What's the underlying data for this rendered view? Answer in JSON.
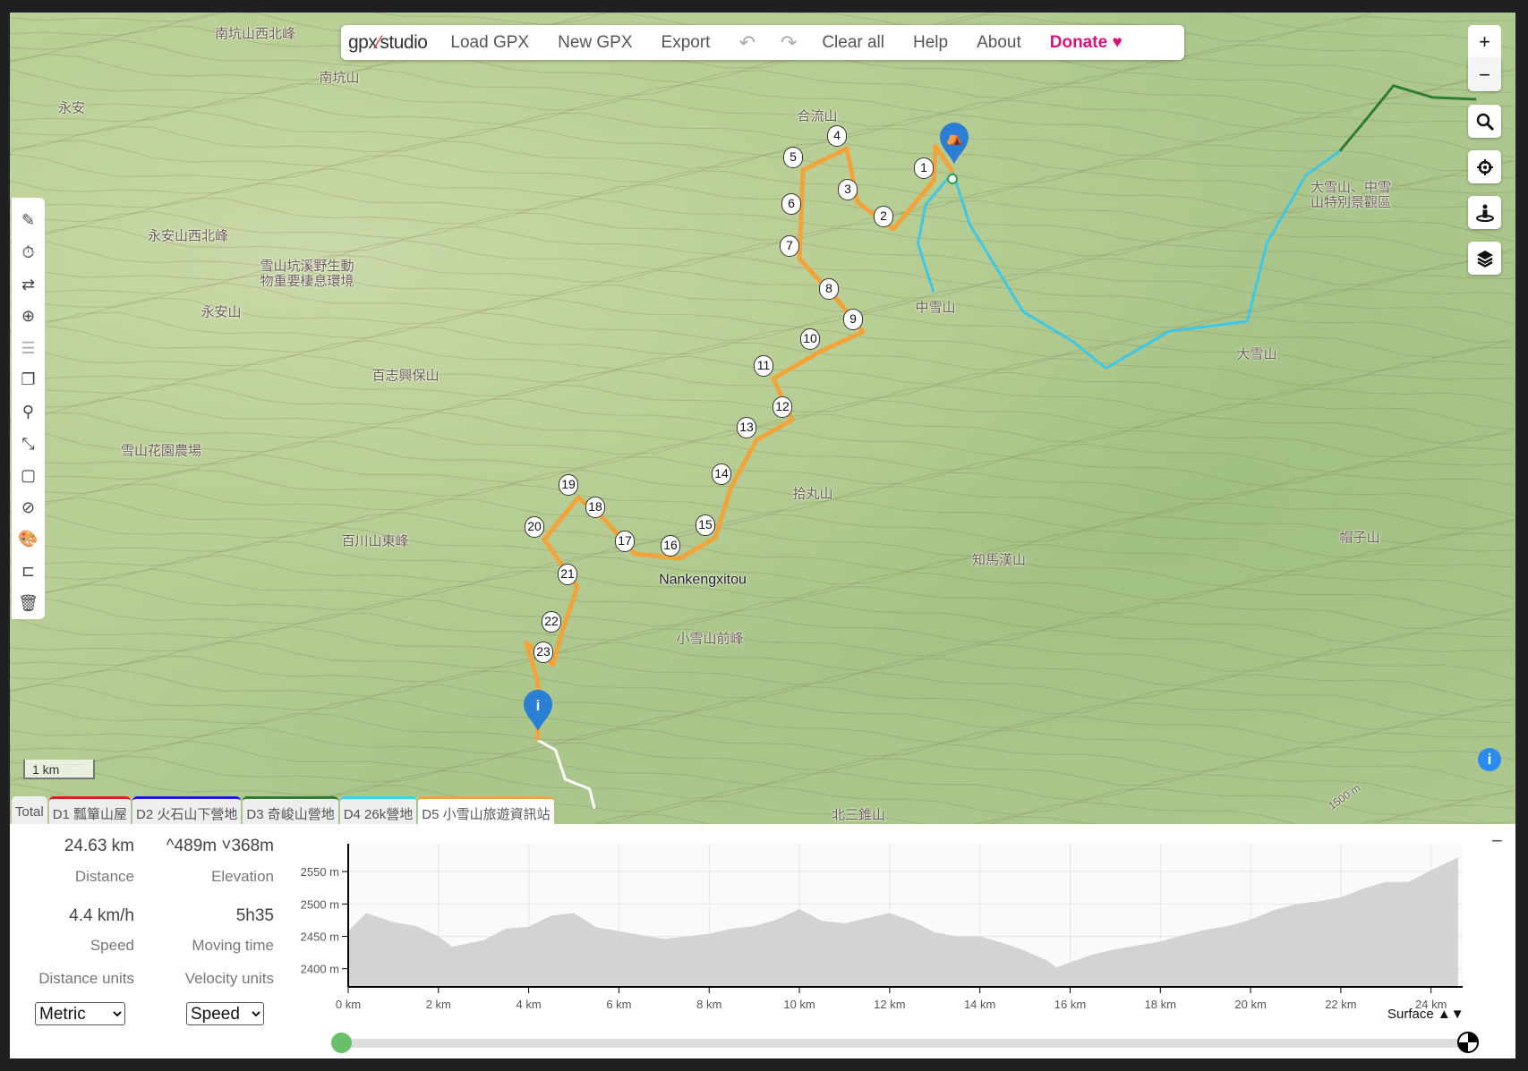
{
  "topbar": {
    "logo_left": "gpx",
    "logo_right": "studio",
    "load": "Load GPX",
    "new": "New GPX",
    "export": "Export",
    "undo_icon": "undo-icon",
    "redo_icon": "redo-icon",
    "clear": "Clear all",
    "help": "Help",
    "about": "About",
    "donate": "Donate",
    "heart": "♥"
  },
  "left_tools": [
    "pencil-icon",
    "stopwatch-icon",
    "reverse-icon",
    "plus-circle-icon",
    "list-icon",
    "copy-icon",
    "map-pin-icon",
    "compress-icon",
    "crop-icon",
    "eye-off-icon",
    "palette-icon",
    "folder-tree-icon",
    "trash-icon"
  ],
  "right_controls": {
    "zoom_in": "+",
    "zoom_out": "−",
    "search": "search-icon",
    "locate": "crosshair-icon",
    "streetview": "person-icon",
    "layers": "layers-icon"
  },
  "map": {
    "places": [
      {
        "t": "南坑山西北峰"
      },
      {
        "t": "南坑山"
      },
      {
        "t": "永安"
      },
      {
        "t": "合流山"
      },
      {
        "t": "永安山西北峰"
      },
      {
        "t": "雪山坑溪野生動\n物重要棲息環境"
      },
      {
        "t": "永安山"
      },
      {
        "t": "中雪山"
      },
      {
        "t": "大雪山、中雪\n山特別景觀區"
      },
      {
        "t": "大雪山"
      },
      {
        "t": "百志興保山"
      },
      {
        "t": "雪山花園農場"
      },
      {
        "t": "拾丸山"
      },
      {
        "t": "百川山東峰"
      },
      {
        "t": "知馬漢山"
      },
      {
        "t": "帽子山"
      },
      {
        "t": "Nankengxitou"
      },
      {
        "t": "小雪山前峰"
      },
      {
        "t": "北三錐山"
      },
      {
        "t": "1500 m"
      }
    ],
    "waypoints": [
      "1",
      "2",
      "3",
      "4",
      "5",
      "6",
      "7",
      "8",
      "9",
      "10",
      "11",
      "12",
      "13",
      "14",
      "15",
      "16",
      "17",
      "18",
      "19",
      "20",
      "21",
      "22",
      "23"
    ],
    "scale": "1 km",
    "route_colors": {
      "current": "#f2a33a",
      "d4": "#3fc7e6",
      "d3": "#2e7d32",
      "after": "#ffffff"
    }
  },
  "tabs": [
    {
      "label": "Total",
      "color": ""
    },
    {
      "label": "D1 瓢簞山屋",
      "color": "#e02020"
    },
    {
      "label": "D2 火石山下營地",
      "color": "#1a1ae0"
    },
    {
      "label": "D3 奇峻山營地",
      "color": "#2e7d32"
    },
    {
      "label": "D4 26k營地",
      "color": "#3fd0f0"
    },
    {
      "label": "D5 小雪山旅遊資訊站",
      "color": "#f2a33a"
    }
  ],
  "stats": {
    "distance": "24.63 km",
    "distance_label": "Distance",
    "elev_up": "489m",
    "elev_down": "368m",
    "elevation_label": "Elevation",
    "speed": "4.4 km/h",
    "speed_label": "Speed",
    "moving_time": "5h35",
    "moving_time_label": "Moving time",
    "distance_units_label": "Distance units",
    "velocity_units_label": "Velocity units",
    "distance_units": "Metric",
    "velocity_units": "Speed"
  },
  "panel": {
    "collapse": "−",
    "surface": "Surface",
    "surface_arrows": "▲▼"
  },
  "chart_data": {
    "type": "area",
    "xlabel": "",
    "ylabel": "",
    "xlim": [
      0,
      24.7
    ],
    "ylim": [
      2372,
      2593
    ],
    "xticks": [
      0,
      2,
      4,
      6,
      8,
      10,
      12,
      14,
      16,
      18,
      20,
      22,
      24
    ],
    "xtick_labels": [
      "0 km",
      "2 km",
      "4 km",
      "6 km",
      "8 km",
      "10 km",
      "12 km",
      "14 km",
      "16 km",
      "18 km",
      "20 km",
      "22 km",
      "24 km"
    ],
    "yticks": [
      2400,
      2450,
      2500,
      2550
    ],
    "ytick_labels": [
      "2400 m",
      "2450 m",
      "2500 m",
      "2550 m"
    ],
    "grid": true,
    "fill": "#d3d3d3",
    "x": [
      0,
      0.4,
      1,
      1.5,
      2,
      2.3,
      3,
      3.5,
      4,
      4.5,
      5,
      5.5,
      6,
      6.5,
      7,
      7.5,
      8,
      8.5,
      9,
      9.5,
      10,
      10.5,
      11,
      11.5,
      12,
      12.5,
      13,
      13.5,
      14,
      14.5,
      15,
      15.5,
      15.7,
      16,
      16.5,
      17,
      17.5,
      18,
      18.5,
      19,
      19.5,
      20,
      20.5,
      21,
      21.5,
      22,
      22.5,
      23,
      23.5,
      24,
      24.6
    ],
    "y": [
      2458,
      2486,
      2472,
      2466,
      2450,
      2434,
      2444,
      2462,
      2465,
      2482,
      2486,
      2464,
      2458,
      2452,
      2446,
      2450,
      2454,
      2462,
      2466,
      2476,
      2492,
      2474,
      2470,
      2478,
      2486,
      2474,
      2456,
      2450,
      2450,
      2440,
      2428,
      2412,
      2402,
      2410,
      2422,
      2430,
      2436,
      2442,
      2452,
      2460,
      2466,
      2476,
      2490,
      2500,
      2504,
      2510,
      2524,
      2534,
      2534,
      2552,
      2572
    ]
  }
}
